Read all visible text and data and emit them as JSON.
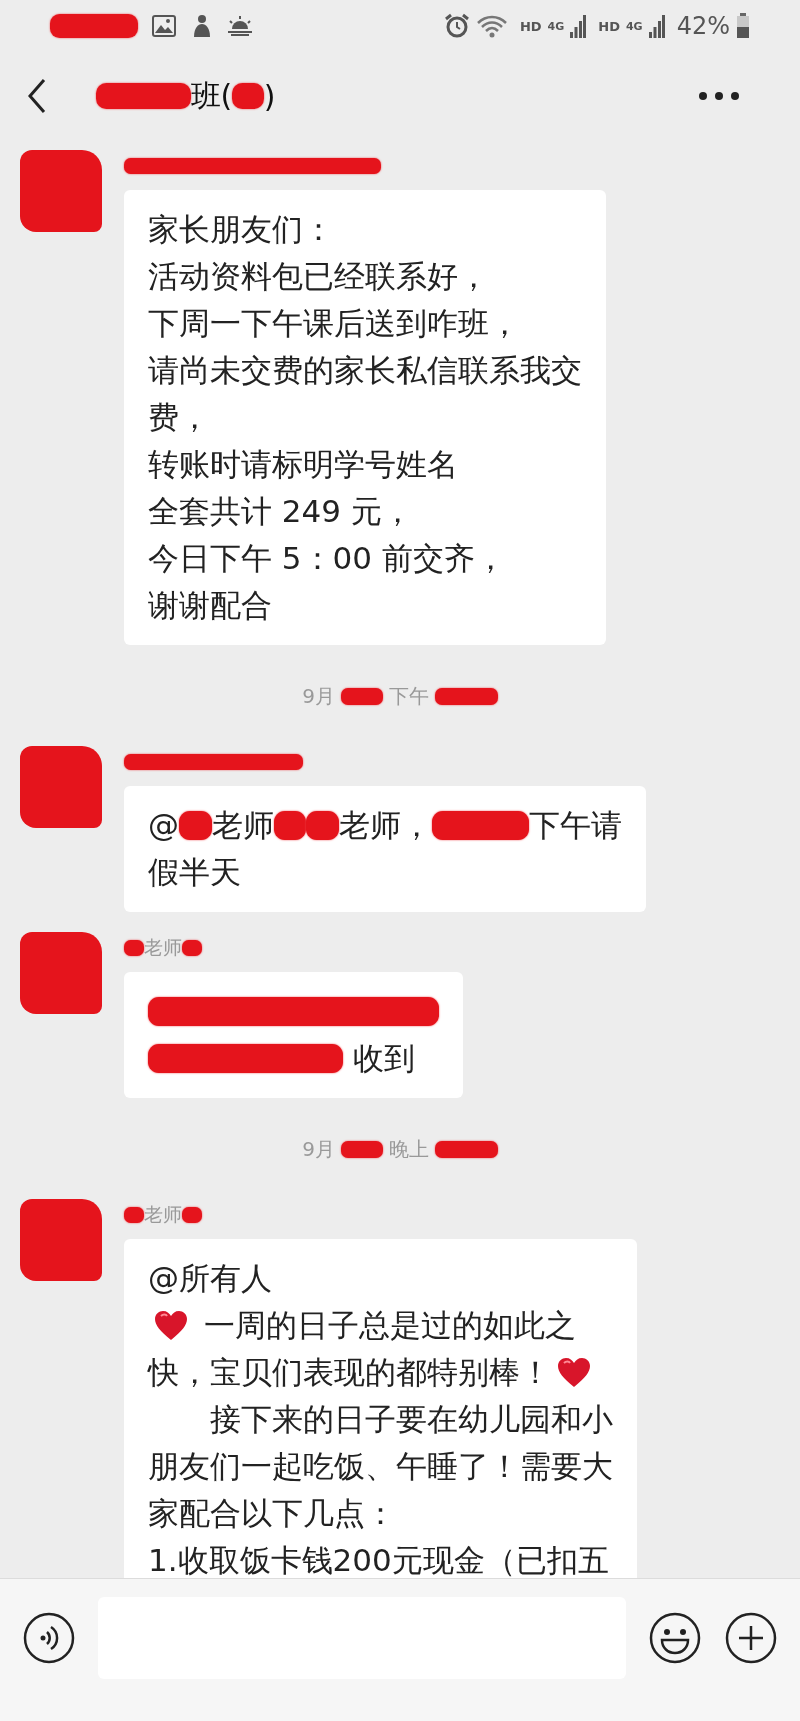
{
  "status_bar": {
    "time": {
      "kind": "smear"
    },
    "hd_labels": [
      "HD",
      "HD"
    ],
    "network_labels": [
      "4G",
      "4G"
    ],
    "battery_text": "42%"
  },
  "header": {
    "title": [
      {
        "kind": "smear"
      },
      {
        "kind": "text",
        "text": "班("
      },
      {
        "kind": "dot"
      },
      {
        "kind": "text",
        "text": ")"
      }
    ]
  },
  "chat": [
    {
      "kind": "message",
      "sender": [
        {
          "kind": "stripe"
        }
      ],
      "lines": [
        [
          {
            "kind": "text",
            "text": "家长朋友们："
          }
        ],
        [
          {
            "kind": "text",
            "text": "活动资料包已经联系好，"
          }
        ],
        [
          {
            "kind": "text",
            "text": "下周一下午课后送到咋班，"
          }
        ],
        [
          {
            "kind": "text",
            "text": "请尚未交费的家长私信联系我交"
          }
        ],
        [
          {
            "kind": "text",
            "text": "费，"
          }
        ],
        [
          {
            "kind": "text",
            "text": "转账时请标明学号姓名"
          }
        ],
        [
          {
            "kind": "text",
            "text": "全套共计 249 元，"
          }
        ],
        [
          {
            "kind": "text",
            "text": "今日下午 5：00 前交齐，"
          }
        ],
        [
          {
            "kind": "text",
            "text": "谢谢配合"
          }
        ]
      ]
    },
    {
      "kind": "timestamp",
      "parts": [
        {
          "kind": "text",
          "text": "9月"
        },
        {
          "kind": "blot"
        },
        {
          "kind": "text",
          "text": "下午"
        },
        {
          "kind": "smear"
        }
      ]
    },
    {
      "kind": "message",
      "sender": [
        {
          "kind": "band"
        }
      ],
      "lines": [
        [
          {
            "kind": "text",
            "text": "@"
          },
          {
            "kind": "dot"
          },
          {
            "kind": "text",
            "text": "老师"
          },
          {
            "kind": "dot"
          },
          {
            "kind": "dot"
          },
          {
            "kind": "text",
            "text": "老师，"
          },
          {
            "kind": "smear"
          },
          {
            "kind": "text",
            "text": "下午请"
          }
        ],
        [
          {
            "kind": "text",
            "text": "假半天"
          }
        ]
      ]
    },
    {
      "kind": "message",
      "sender": [
        {
          "kind": "dot"
        },
        {
          "kind": "text",
          "text": "老师"
        },
        {
          "kind": "dot"
        }
      ],
      "lines": [
        [
          {
            "kind": "band"
          }
        ],
        [
          {
            "kind": "bar"
          },
          {
            "kind": "text",
            "text": " 收到"
          }
        ]
      ]
    },
    {
      "kind": "timestamp",
      "parts": [
        {
          "kind": "text",
          "text": "9月"
        },
        {
          "kind": "blot"
        },
        {
          "kind": "text",
          "text": "晚上"
        },
        {
          "kind": "smear"
        }
      ]
    },
    {
      "kind": "message",
      "sender": [
        {
          "kind": "dot"
        },
        {
          "kind": "text",
          "text": "老师"
        },
        {
          "kind": "dot"
        }
      ],
      "lines": [
        [
          {
            "kind": "text",
            "text": "@所有人"
          }
        ],
        [
          {
            "kind": "heart"
          },
          {
            "kind": "text",
            "text": " 一周的日子总是过的如此之"
          }
        ],
        [
          {
            "kind": "text",
            "text": "快，宝贝们表现的都特别棒！"
          },
          {
            "kind": "heart"
          }
        ],
        [
          {
            "kind": "text",
            "text": "　　接下来的日子要在幼儿园和小"
          }
        ],
        [
          {
            "kind": "text",
            "text": "朋友们一起吃饭、午睡了！需要大"
          }
        ],
        [
          {
            "kind": "text",
            "text": "家配合以下几点："
          }
        ],
        [
          {
            "kind": "text",
            "text": "1.收取饭卡钱200元现金（已扣五"
          }
        ]
      ]
    }
  ]
}
